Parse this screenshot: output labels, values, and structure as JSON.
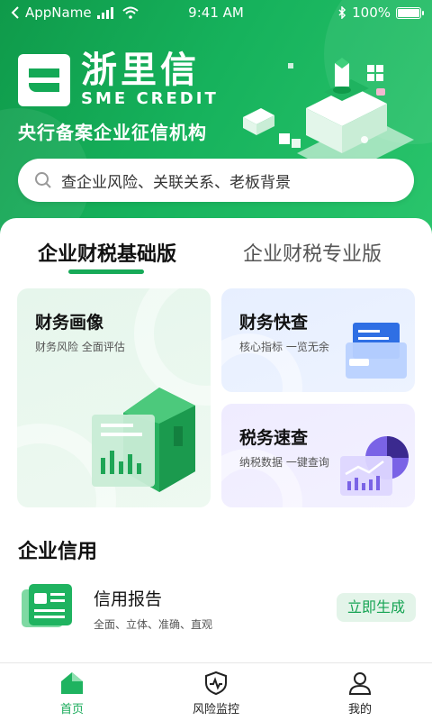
{
  "status_bar": {
    "carrier": "AppName",
    "time": "9:41 AM",
    "battery": "100%"
  },
  "brand": {
    "name_cn": "浙里信",
    "name_en": "SME CREDIT",
    "tagline": "央行备案企业征信机构"
  },
  "search": {
    "placeholder": "查企业风险、关联关系、老板背景",
    "icon": "search-icon"
  },
  "tabs": [
    {
      "label": "企业财税基础版",
      "active": true
    },
    {
      "label": "企业财税专业版",
      "active": false
    }
  ],
  "cards": [
    {
      "title": "财务画像",
      "subtitle": "财务风险 全面评估",
      "icon": "finance-portrait-illustration"
    },
    {
      "title": "财务快查",
      "subtitle": "核心指标 一览无余",
      "icon": "folder-illustration"
    },
    {
      "title": "税务速查",
      "subtitle": "纳税数据 一键查询",
      "icon": "chart-illustration"
    }
  ],
  "enterprise_credit": {
    "section_title": "企业信用",
    "item_title": "信用报告",
    "item_subtitle": "全面、立体、准确、直观",
    "action_label": "立即生成",
    "icon": "credit-report-icon"
  },
  "tabbar": [
    {
      "label": "首页",
      "icon": "home-icon",
      "active": true
    },
    {
      "label": "风险监控",
      "icon": "shield-pulse-icon",
      "active": false
    },
    {
      "label": "我的",
      "icon": "user-icon",
      "active": false
    }
  ],
  "colors": {
    "brand_green": "#17aa58",
    "header_gradient_start": "#0f9a4a",
    "header_gradient_end": "#2ac56c",
    "action_button_bg": "#e3f4e9"
  }
}
